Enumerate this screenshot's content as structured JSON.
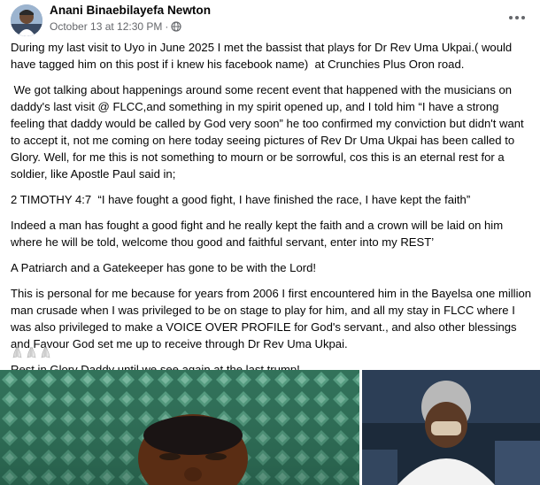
{
  "post": {
    "author": "Anani Binaebilayefa Newton",
    "timestamp": "October 13 at 12:30 PM",
    "audience_icon": "globe-icon",
    "more_icon": "more-options-icon",
    "paragraphs": [
      "During my last visit to Uyo in June 2025 I met the bassist that plays for Dr Rev Uma Ukpai.( would have tagged him on this post if i knew his facebook name)  at Crunchies Plus Oron road.",
      " We got talking about happenings around some recent event that happened with the musicians on daddy's last visit @ FLCC,and something in my spirit opened up, and I told him “I have a strong feeling that daddy would be called by God very soon” he too confirmed my conviction but didn't want to accept it, not me coming on here today seeing pictures of Rev Dr Uma Ukpai has been called to Glory. Well, for me this is not something to mourn or be sorrowful, cos this is an eternal rest for a soldier, like Apostle Paul said in;",
      "2 TIMOTHY 4:7  “I have fought a good fight, I have finished the race, I have kept the faith”",
      "Indeed a man has fought a good fight and he really kept the faith and a crown will be laid on him where he will be told, welcome thou good and faithful servant, enter into my REST’",
      "A Patriarch and a Gatekeeper has gone to be with the Lord!",
      "This is personal for me because for years from 2006 I first encountered him in the Bayelsa one million man crusade when I was privileged to be on stage to play for him, and all my stay in FLCC where I was also privileged to make a VOICE OVER PROFILE for God's servant., and also other blessings and Favour God set me up to receive through Dr Rev Uma Ukpai.",
      "Rest in Glory Daddy until we see again at the last trump!"
    ],
    "emoji": "praying-hands-emoji",
    "emoji_count": 3
  },
  "colors": {
    "text": "#050505",
    "secondary": "#65676b",
    "background": "#ffffff"
  }
}
